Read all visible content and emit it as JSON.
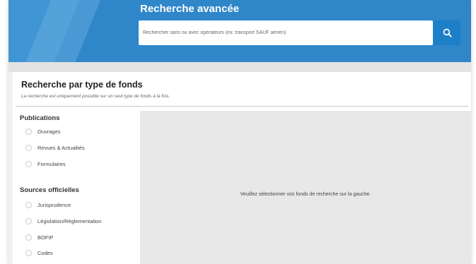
{
  "header": {
    "title": "Recherche avancée",
    "search_placeholder": "Rechercher sans ou avec opérateurs (ex: transport SAUF aérien)",
    "search_button_icon": "search-icon"
  },
  "panel": {
    "title": "Recherche par type de fonds",
    "subtitle": "La recherche est uniquement possible sur un seul type de fonds à la fois."
  },
  "sections": [
    {
      "title": "Publications",
      "options": [
        {
          "label": "Ouvrages"
        },
        {
          "label": "Revues & Actualités"
        },
        {
          "label": "Formulaires"
        }
      ]
    },
    {
      "title": "Sources officielles",
      "options": [
        {
          "label": "Jurisprudence"
        },
        {
          "label": "Législation/Réglementation"
        },
        {
          "label": "BOFIP"
        },
        {
          "label": "Codes"
        }
      ]
    }
  ],
  "results": {
    "message": "Veuillez sélectionner vos fonds de recherche sur la gauche."
  },
  "colors": {
    "header_blue": "#2f86c9",
    "search_button": "#1d7fc7",
    "results_bg": "#e8e8e8"
  }
}
